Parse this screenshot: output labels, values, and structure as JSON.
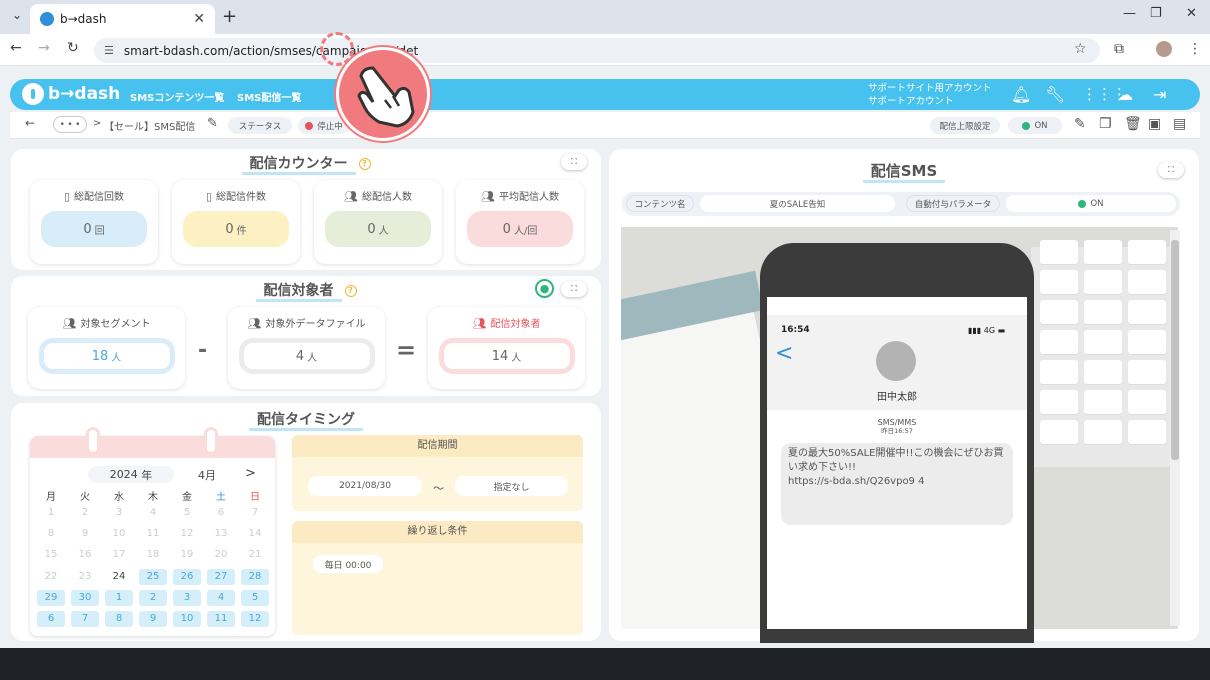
{
  "browser": {
    "tab_title": "b→dash",
    "url": "smart-bdash.com/action/smses/campaign/51/det"
  },
  "header": {
    "logo": "b→dash",
    "nav": [
      "SMSコンテンツ一覧",
      "SMS配信一覧"
    ],
    "account_line1": "サポートサイト用アカウント",
    "account_line2": "サポートアカウント"
  },
  "subbar": {
    "ellipsis": "• • •",
    "sep": ">",
    "breadcrumb": "【セール】SMS配信",
    "status_label": "ステータス",
    "status_value": "停止中",
    "limit_label": "配信上限設定",
    "limit_value": "ON"
  },
  "counter": {
    "title": "配信カウンター",
    "help": "?",
    "items": [
      {
        "label": "総配信回数",
        "value": "0",
        "unit": "回"
      },
      {
        "label": "総配信件数",
        "value": "0",
        "unit": "件"
      },
      {
        "label": "総配信人数",
        "value": "0",
        "unit": "人"
      },
      {
        "label": "平均配信人数",
        "value": "0",
        "unit": "人/回"
      }
    ]
  },
  "target": {
    "title": "配信対象者",
    "help": "?",
    "minus": "-",
    "equals": "=",
    "segment": {
      "label": "対象セグメント",
      "value": "18",
      "unit": "人"
    },
    "excluded": {
      "label": "対象外データファイル",
      "value": "4",
      "unit": "人"
    },
    "result": {
      "label": "配信対象者",
      "value": "14",
      "unit": "人"
    }
  },
  "timing": {
    "title": "配信タイミング",
    "calendar": {
      "year": "2024",
      "year_suffix": "年",
      "month": "4月",
      "next": ">",
      "weekdays": [
        "月",
        "火",
        "水",
        "木",
        "金",
        "土",
        "日"
      ],
      "rows": [
        [
          "1",
          "2",
          "3",
          "4",
          "5",
          "6",
          "7"
        ],
        [
          "8",
          "9",
          "10",
          "11",
          "12",
          "13",
          "14"
        ],
        [
          "15",
          "16",
          "17",
          "18",
          "19",
          "20",
          "21"
        ],
        [
          "22",
          "23",
          "24",
          "25",
          "26",
          "27",
          "28"
        ],
        [
          "29",
          "30",
          "1",
          "2",
          "3",
          "4",
          "5"
        ],
        [
          "6",
          "7",
          "8",
          "9",
          "10",
          "11",
          "12"
        ]
      ]
    },
    "period_label": "配信期間",
    "period_start": "2021/08/30",
    "period_sep": "〜",
    "period_end": "指定なし",
    "repeat_label": "繰り返し条件",
    "repeat_value": "毎日 00:00"
  },
  "sms": {
    "title": "配信SMS",
    "content_label": "コンテンツ名",
    "content_value": "夏のSALE告知",
    "autoparam_label": "自動付与パラメータ",
    "autoparam_value": "ON",
    "phone_time": "16:54",
    "phone_signal": "4G",
    "back": "<",
    "contact_name": "田中太郎",
    "msg_type": "SMS/MMS",
    "msg_time": "昨日16:57",
    "message": "夏の最大50%SALE開催中!!この機会にぜひお買い求め下さい!!\nhttps://s-bda.sh/Q26vpo9 4"
  },
  "colors": {
    "brand": "#47c1ee",
    "counter_blue": "#d8ecfa",
    "counter_yellow": "#fdf0c2",
    "counter_green": "#e6eed9",
    "counter_pink": "#fbdcdc",
    "cursor": "#f07a7e"
  }
}
